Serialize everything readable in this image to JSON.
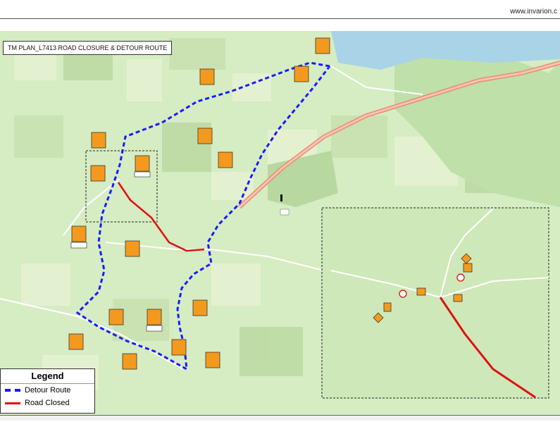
{
  "header": {
    "url": "www.invarion.c"
  },
  "map": {
    "title": "TM PLAN_L7413 ROAD CLOSURE & DETOUR ROUTE",
    "legend": {
      "title": "Legend",
      "items": [
        {
          "label": "Detour Route",
          "color": "#1a1aff",
          "style": "dashed"
        },
        {
          "label": "Road Closed",
          "color": "#e01010",
          "style": "solid"
        }
      ]
    },
    "colors": {
      "land": "#d6ecc3",
      "field_light": "#e6f2d2",
      "field_dark": "#bddba3",
      "forest": "#9fd08a",
      "water": "#a9d3e6",
      "main_road": "#f2a58e",
      "sign_orange": "#f39a1e"
    }
  }
}
